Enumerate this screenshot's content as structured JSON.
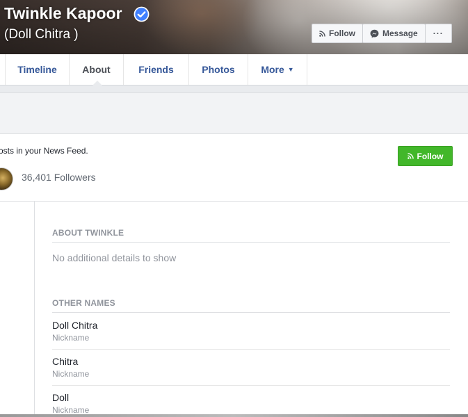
{
  "profile": {
    "name": "Twinkle Kapoor",
    "alternate_name": "(Doll Chitra )",
    "verified_icon": "verified-check-icon"
  },
  "cover_actions": {
    "follow_label": "Follow",
    "message_label": "Message",
    "more_label": "···"
  },
  "nav": {
    "tabs": [
      {
        "label": "Timeline"
      },
      {
        "label": "About"
      },
      {
        "label": "Friends"
      },
      {
        "label": "Photos"
      },
      {
        "label": "More"
      }
    ],
    "active_tab": "About"
  },
  "follow_info": {
    "feed_text": "osts in your News Feed.",
    "follower_count": "36,401 Followers",
    "follow_button": "Follow"
  },
  "about": {
    "heading": "ABOUT TWINKLE",
    "no_details": "No additional details to show"
  },
  "other_names": {
    "heading": "OTHER NAMES",
    "items": [
      {
        "value": "Doll Chitra",
        "type": "Nickname"
      },
      {
        "value": "Chitra",
        "type": "Nickname"
      },
      {
        "value": "Doll",
        "type": "Nickname"
      }
    ]
  },
  "colors": {
    "link_blue": "#365899",
    "follow_green": "#42b72a",
    "verified_blue": "#4080ff",
    "muted_text": "#90949c"
  }
}
